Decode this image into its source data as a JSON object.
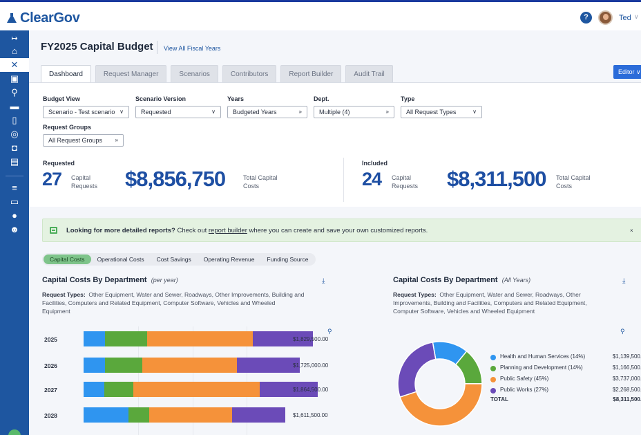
{
  "app": {
    "brand": "ClearGov",
    "user_name": "Ted",
    "help_label": "?"
  },
  "sidebar": {
    "icons": [
      "collapse-icon",
      "home-icon",
      "tools-icon",
      "clipboard-icon",
      "org-chart-icon",
      "briefcase-icon",
      "document-icon",
      "target-icon",
      "search-doc-icon",
      "form-icon",
      "database-icon",
      "monitor-icon",
      "chat-icon",
      "users-icon"
    ]
  },
  "page": {
    "title": "FY2025 Capital Budget",
    "view_all": "View All Fiscal Years",
    "editor_label": "Editor"
  },
  "tabs": [
    "Dashboard",
    "Request Manager",
    "Scenarios",
    "Contributors",
    "Report Builder",
    "Audit Trail"
  ],
  "filters": {
    "budget_view": {
      "label": "Budget View",
      "value": "Scenario - Test scenario"
    },
    "scenario_version": {
      "label": "Scenario Version",
      "value": "Requested"
    },
    "years": {
      "label": "Years",
      "value": "Budgeted Years"
    },
    "dept": {
      "label": "Dept.",
      "value": "Multiple (4)"
    },
    "type": {
      "label": "Type",
      "value": "All Request Types"
    },
    "request_groups": {
      "label": "Request Groups",
      "value": "All Request Groups"
    }
  },
  "stats": {
    "requested": {
      "heading": "Requested",
      "count": "27",
      "count_label": "Capital\nRequests",
      "amount": "$8,856,750",
      "amount_label": "Total Capital\nCosts"
    },
    "included": {
      "heading": "Included",
      "count": "24",
      "count_label": "Capital\nRequests",
      "amount": "$8,311,500",
      "amount_label": "Total Capital\nCosts"
    }
  },
  "notice": {
    "bold": "Looking for more detailed reports?",
    "text1": " Check out ",
    "link": "report builder",
    "text2": " where you can create and save your own customized reports.",
    "close": "×"
  },
  "cost_tabs": [
    "Capital Costs",
    "Operational Costs",
    "Cost Savings",
    "Operating Revenue",
    "Funding Source"
  ],
  "bar_card": {
    "title": "Capital Costs By Department",
    "subtitle": "(per year)",
    "desc_label": "Request Types:",
    "desc": "Other Equipment, Water and Sewer, Roadways, Other Improvements, Building and Facilities, Computers and Related Equipment, Computer Software, Vehicles and Wheeled Equipment"
  },
  "donut_card": {
    "title": "Capital Costs By Department",
    "subtitle": "(All Years)",
    "desc_label": "Request Types:",
    "desc": "Other Equipment, Water and Sewer, Roadways, Other Improvements, Building and Facilities, Computers and Related Equipment, Computer Software, Vehicles and Wheeled Equipment"
  },
  "colors": {
    "health": "#2f95f0",
    "planning": "#5aa83c",
    "safety": "#f5923a",
    "works": "#6b4bb8",
    "brand": "#1e56a0"
  },
  "chart_data": [
    {
      "type": "bar",
      "title": "Capital Costs By Department",
      "categories": [
        "2025",
        "2026",
        "2027",
        "2028"
      ],
      "totals": [
        "$1,829,500.00",
        "$1,725,000.00",
        "$1,864,500.00",
        "$1,611,500.00"
      ],
      "series": [
        {
          "key": "health",
          "values": [
            240000,
            240000,
            230000,
            500000
          ]
        },
        {
          "key": "planning",
          "values": [
            470000,
            420000,
            330000,
            240000
          ]
        },
        {
          "key": "safety",
          "values": [
            1190000,
            1060000,
            1420000,
            930000
          ]
        },
        {
          "key": "works",
          "values": [
            670000,
            710000,
            650000,
            590000
          ]
        }
      ],
      "xlim": [
        0,
        2000000
      ]
    },
    {
      "type": "pie",
      "title": "Capital Costs By Department",
      "slices": [
        {
          "key": "health",
          "label": "Health and Human Services (14%)",
          "value": 1139500,
          "display": "$1,139,500.00"
        },
        {
          "key": "planning",
          "label": "Planning and Development (14%)",
          "value": 1166500,
          "display": "$1,166,500.00"
        },
        {
          "key": "safety",
          "label": "Public Safety (45%)",
          "value": 3737000,
          "display": "$3,737,000.00"
        },
        {
          "key": "works",
          "label": "Public Works (27%)",
          "value": 2268500,
          "display": "$2,268,500.00"
        }
      ],
      "total_label": "TOTAL",
      "total_display": "$8,311,500.00"
    }
  ]
}
